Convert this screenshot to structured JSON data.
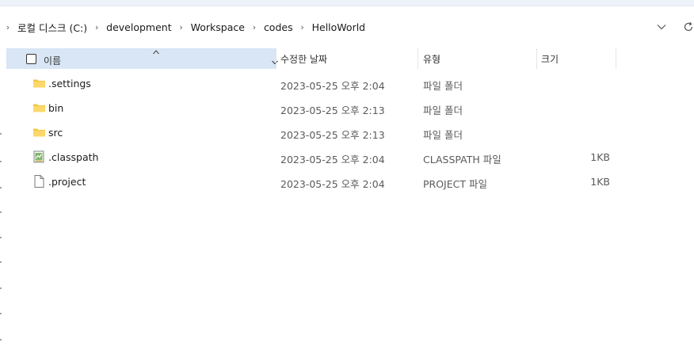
{
  "address_bar": {
    "crumbs": [
      "로컬 디스크 (C:)",
      "development",
      "Workspace",
      "codes",
      "HelloWorld"
    ],
    "icons": {
      "separator": "chevron-right-icon",
      "history": "chevron-down-icon",
      "refresh": "refresh-icon"
    }
  },
  "columns": {
    "name": "이름",
    "date_modified": "수정한 날짜",
    "type": "유형",
    "size": "크기"
  },
  "files": [
    {
      "name": ".settings",
      "modified": "2023-05-25 오후 2:04",
      "type": "파일 폴더",
      "size": "",
      "icon": "folder-icon"
    },
    {
      "name": "bin",
      "modified": "2023-05-25 오후 2:13",
      "type": "파일 폴더",
      "size": "",
      "icon": "folder-icon"
    },
    {
      "name": "src",
      "modified": "2023-05-25 오후 2:13",
      "type": "파일 폴더",
      "size": "",
      "icon": "folder-icon"
    },
    {
      "name": ".classpath",
      "modified": "2023-05-25 오후 2:04",
      "type": "CLASSPATH 파일",
      "size": "1KB",
      "icon": "classpath-file-icon"
    },
    {
      "name": ".project",
      "modified": "2023-05-25 오후 2:04",
      "type": "PROJECT 파일",
      "size": "1KB",
      "icon": "document-icon"
    }
  ],
  "colors": {
    "header_selected": "#d8e6f5",
    "folder": "#f5c542"
  }
}
